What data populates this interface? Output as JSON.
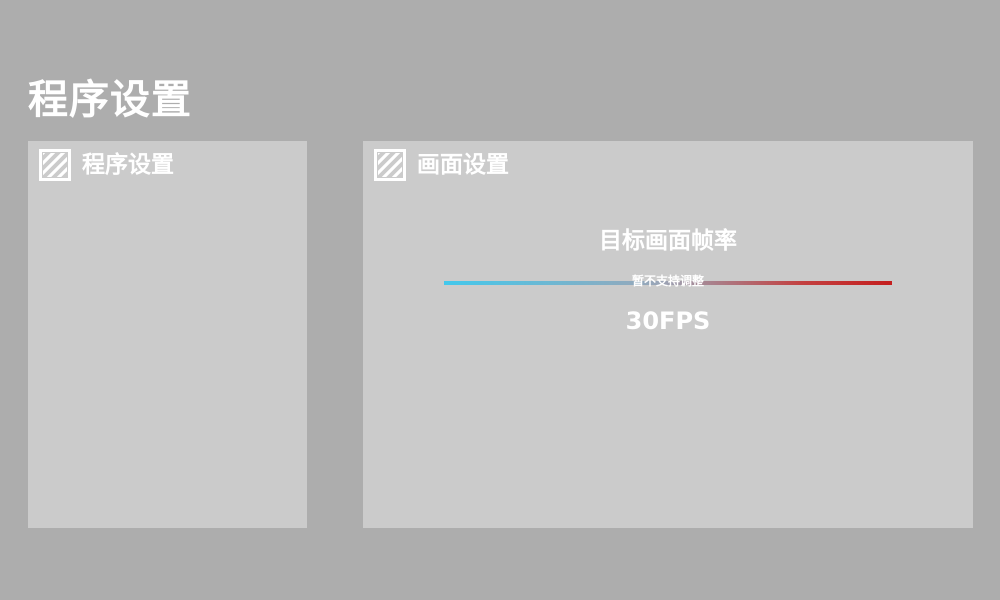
{
  "page": {
    "title": "程序设置"
  },
  "panels": {
    "program": {
      "title": "程序设置",
      "icon": "hatched-square-icon"
    },
    "display": {
      "title": "画面设置",
      "icon": "hatched-square-icon",
      "frame_rate": {
        "label": "目标画面帧率",
        "note": "暂不支持调整",
        "value": "30FPS"
      }
    }
  },
  "colors": {
    "background": "#adadad",
    "panel": "#cbcbcb",
    "text": "#ffffff",
    "slider_start": "#42c8ec",
    "slider_end": "#c41e1e"
  }
}
